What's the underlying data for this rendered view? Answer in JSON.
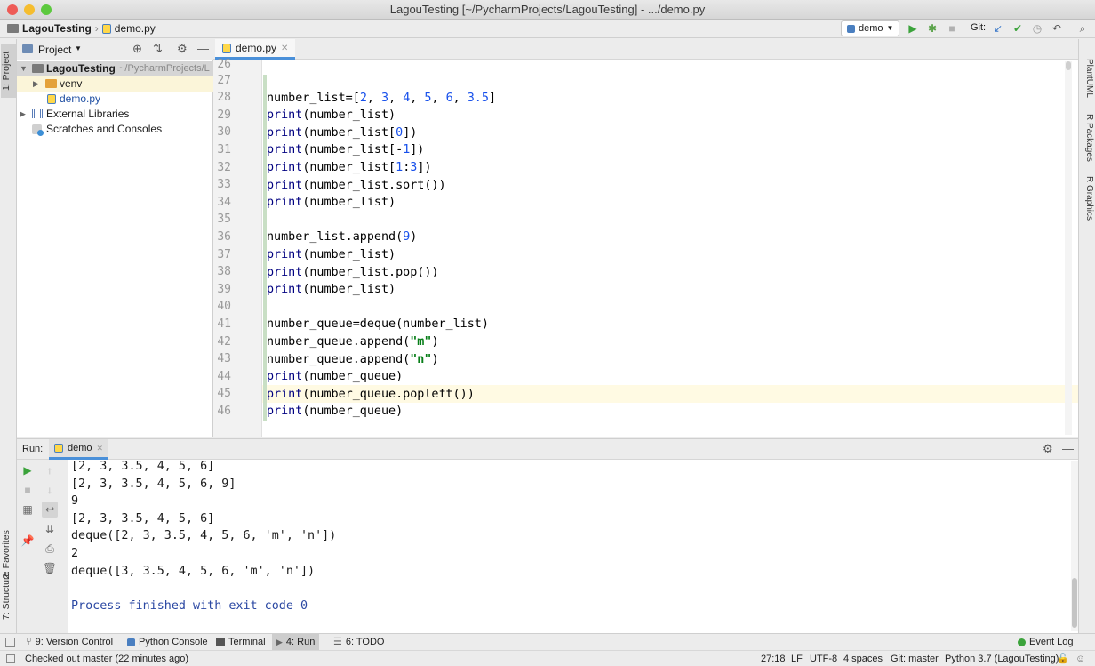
{
  "window": {
    "title": "LagouTesting [~/PycharmProjects/LagouTesting] - .../demo.py"
  },
  "nav": {
    "project": "LagouTesting",
    "file": "demo.py",
    "run_config": "demo",
    "git_label": "Git:"
  },
  "project_panel": {
    "header": "Project",
    "tree": [
      {
        "label": "LagouTesting",
        "suffix": "~/PycharmProjects/L"
      },
      {
        "label": "venv"
      },
      {
        "label": "demo.py"
      },
      {
        "label": "External Libraries"
      },
      {
        "label": "Scratches and Consoles"
      }
    ]
  },
  "left_tabs": {
    "project": "1: Project",
    "favorites": "2: Favorites",
    "structure": "7: Structure"
  },
  "right_tabs": [
    "PlantUML",
    "R Packages",
    "R Graphics"
  ],
  "editor": {
    "tab": "demo.py",
    "line_numbers": [
      "26",
      "27",
      "28",
      "29",
      "30",
      "31",
      "32",
      "33",
      "34",
      "35",
      "36",
      "37",
      "38",
      "39",
      "40",
      "41",
      "42",
      "43",
      "44",
      "45",
      "46"
    ]
  },
  "run": {
    "label": "Run:",
    "tab": "demo",
    "output": [
      "[2, 3, 3.5, 4, 5, 6]",
      "[2, 3, 3.5, 4, 5, 6, 9]",
      "9",
      "[2, 3, 3.5, 4, 5, 6]",
      "deque([2, 3, 3.5, 4, 5, 6, 'm', 'n'])",
      "2",
      "deque([3, 3.5, 4, 5, 6, 'm', 'n'])",
      "",
      "Process finished with exit code 0"
    ]
  },
  "bottom_tabs": {
    "vcs": "9: Version Control",
    "console": "Python Console",
    "terminal": "Terminal",
    "run": "4: Run",
    "todo": "6: TODO",
    "event_log": "Event Log"
  },
  "status": {
    "message": "Checked out master (22 minutes ago)",
    "position": "27:18",
    "line_sep": "LF",
    "encoding": "UTF-8",
    "indent": "4 spaces",
    "git": "Git: master",
    "interpreter": "Python 3.7 (LagouTesting)"
  },
  "colors": {
    "keyword": "#000080",
    "number": "#1750eb",
    "string": "#067d17",
    "current_line": "#fffae3",
    "accent": "#4a90d9"
  }
}
